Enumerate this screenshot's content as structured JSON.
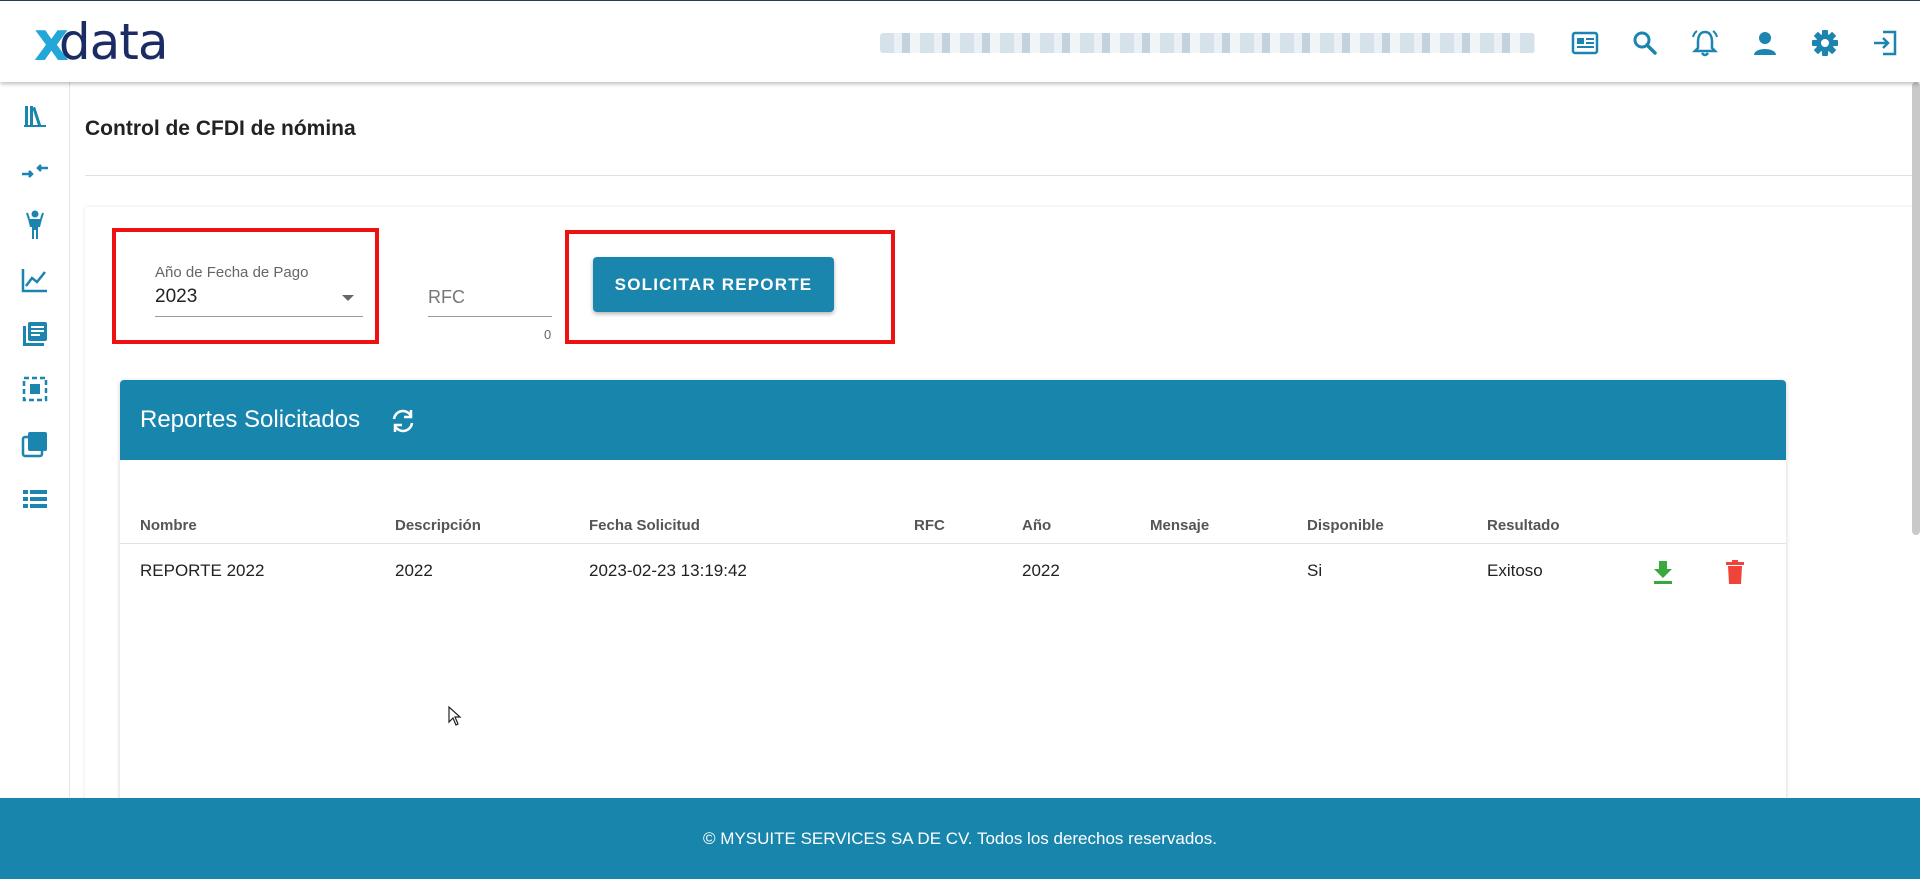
{
  "header": {
    "logo_x": "x",
    "logo_data": "data",
    "icons": [
      "news-icon",
      "search-icon",
      "notification-bell-icon",
      "user-icon",
      "settings-gear-icon",
      "logout-icon"
    ]
  },
  "sidebar": {
    "icons": [
      "library-icon",
      "compress-arrows-icon",
      "person-icon",
      "chart-line-icon",
      "book-list-icon",
      "select-box-icon",
      "layers-icon",
      "list-icon"
    ]
  },
  "page": {
    "title": "Control de CFDI de nómina"
  },
  "filters": {
    "year_label": "Año de Fecha de Pago",
    "year_value": "2023",
    "rfc_placeholder": "RFC",
    "rfc_counter": "0",
    "request_button": "SOLICITAR REPORTE"
  },
  "reports": {
    "title": "Reportes Solicitados",
    "columns": [
      "Nombre",
      "Descripción",
      "Fecha Solicitud",
      "RFC",
      "Año",
      "Mensaje",
      "Disponible",
      "Resultado"
    ],
    "rows": [
      {
        "nombre": "REPORTE 2022",
        "descripcion": "2022",
        "fecha": "2023-02-23 13:19:42",
        "rfc": "",
        "anio": "2022",
        "mensaje": "",
        "disponible": "Si",
        "resultado": "Exitoso"
      }
    ]
  },
  "footer": {
    "text": "© MYSUITE SERVICES SA DE CV. Todos los derechos reservados."
  },
  "colors": {
    "primary": "#1885ad",
    "highlight": "#e11111",
    "download": "#3aa83a",
    "delete": "#f0443a"
  }
}
